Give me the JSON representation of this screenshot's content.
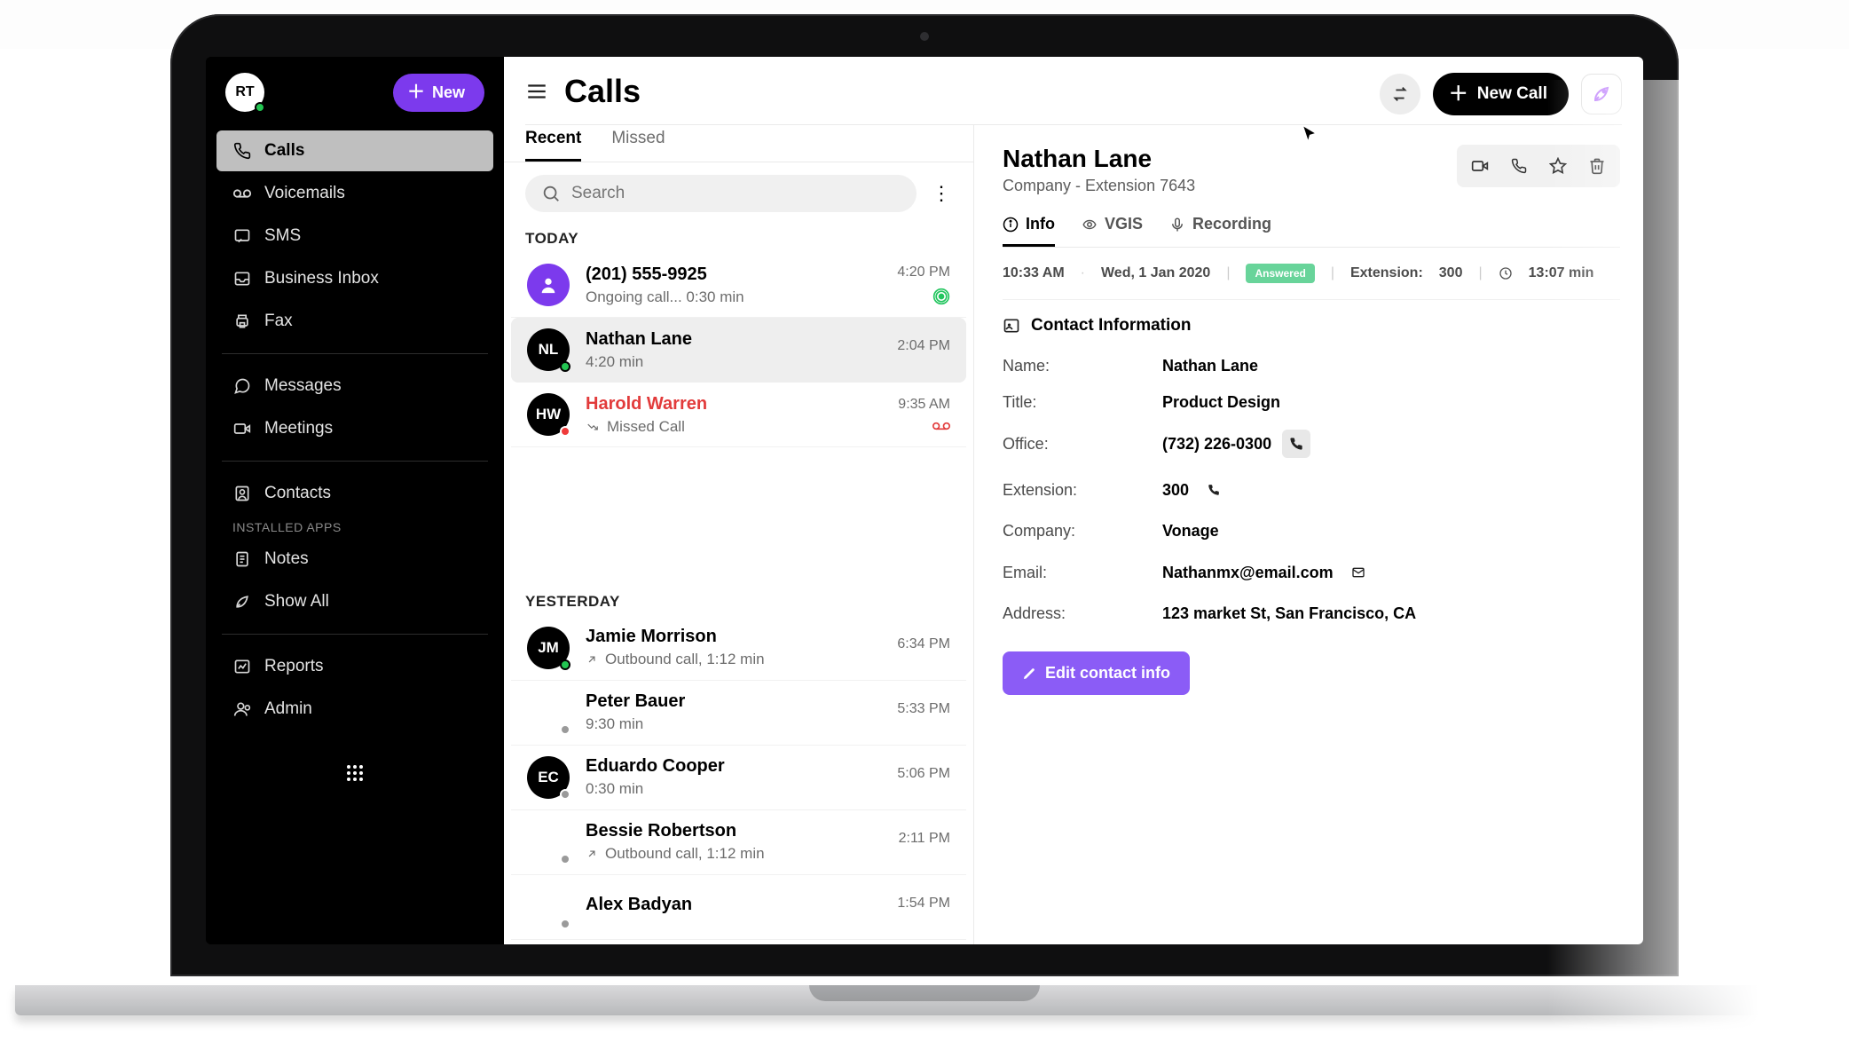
{
  "sidebar": {
    "avatar_initials": "RT",
    "new_button": "New",
    "items": [
      {
        "label": "Calls"
      },
      {
        "label": "Voicemails"
      },
      {
        "label": "SMS"
      },
      {
        "label": "Business Inbox"
      },
      {
        "label": "Fax"
      }
    ],
    "items2": [
      {
        "label": "Messages"
      },
      {
        "label": "Meetings"
      }
    ],
    "items3": [
      {
        "label": "Contacts"
      }
    ],
    "installed_label": "INSTALLED APPS",
    "items4": [
      {
        "label": "Notes"
      },
      {
        "label": "Show All"
      }
    ],
    "items5": [
      {
        "label": "Reports"
      },
      {
        "label": "Admin"
      }
    ]
  },
  "header": {
    "title": "Calls",
    "new_call_label": "New Call"
  },
  "tabs": {
    "recent": "Recent",
    "missed": "Missed"
  },
  "search": {
    "placeholder": "Search"
  },
  "groups": {
    "today": "TODAY",
    "yesterday": "YESTERDAY"
  },
  "calls": {
    "today": [
      {
        "title": "(201) 555-9925",
        "sub": "Ongoing call... 0:30 min",
        "time": "4:20 PM",
        "avatar_bg": "#7c3aed",
        "avatar_kind": "icon",
        "badge": "live"
      },
      {
        "title": "Nathan Lane",
        "sub": "4:20 min",
        "time": "2:04 PM",
        "avatar_bg": "#000",
        "avatar_text": "NL",
        "presence": "green",
        "selected": true
      },
      {
        "title": "Harold Warren",
        "sub": "Missed Call",
        "time": "9:35 AM",
        "avatar_bg": "#000",
        "avatar_text": "HW",
        "presence": "red",
        "missed": true,
        "sub_icon": "missed"
      }
    ],
    "yesterday": [
      {
        "title": "Jamie Morrison",
        "sub": "Outbound call, 1:12 min",
        "time": "6:34 PM",
        "avatar_bg": "#000",
        "avatar_text": "JM",
        "presence": "green",
        "sub_icon": "out"
      },
      {
        "title": "Peter Bauer",
        "sub": "9:30 min",
        "time": "5:33 PM",
        "avatar_bg": "none",
        "presence": "gray"
      },
      {
        "title": "Eduardo Cooper",
        "sub": "0:30 min",
        "time": "5:06 PM",
        "avatar_bg": "#000",
        "avatar_text": "EC",
        "presence": "gray"
      },
      {
        "title": "Bessie Robertson",
        "sub": "Outbound call, 1:12 min",
        "time": "2:11 PM",
        "avatar_bg": "none",
        "sub_icon": "out"
      },
      {
        "title": "Alex Badyan",
        "sub": "",
        "time": "1:54 PM",
        "avatar_bg": "none"
      }
    ]
  },
  "detail": {
    "name": "Nathan Lane",
    "subtitle": "Company -  Extension 7643",
    "tabs": {
      "info": "Info",
      "vgis": "VGIS",
      "recording": "Recording"
    },
    "meta": {
      "time": "10:33 AM",
      "dot": "·",
      "date": "Wed, 1 Jan 2020",
      "status": "Answered",
      "ext_label": "Extension:",
      "ext_value": "300",
      "dur": "13:07 min"
    },
    "section_title": "Contact Information",
    "fields": {
      "name_k": "Name:",
      "name_v": "Nathan Lane",
      "title_k": "Title:",
      "title_v": "Product  Design",
      "office_k": "Office:",
      "office_v": "(732) 226-0300",
      "ext_k": "Extension:",
      "ext_v": "300",
      "company_k": "Company:",
      "company_v": "Vonage",
      "email_k": "Email:",
      "email_v": "Nathanmx@email.com",
      "address_k": "Address:",
      "address_v": "123 market St, San Francisco, CA"
    },
    "edit_label": "Edit contact info"
  }
}
